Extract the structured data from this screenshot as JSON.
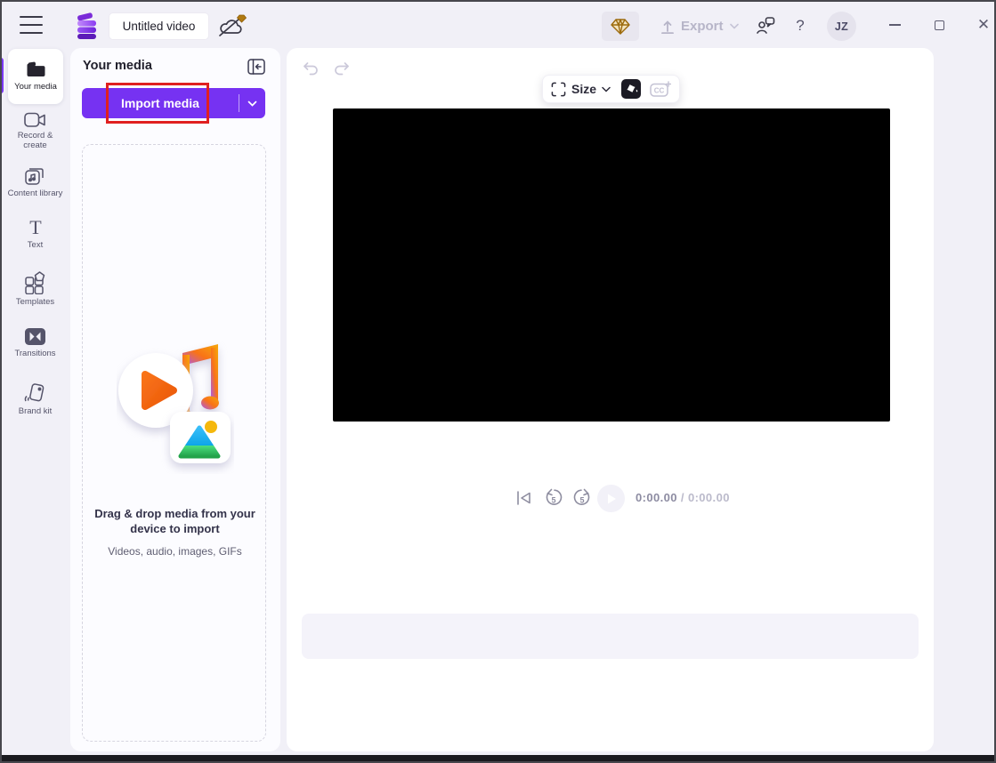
{
  "titlebar": {
    "title_value": "Untitled video",
    "export_label": "Export",
    "help_label": "?",
    "avatar_initials": "JZ",
    "close_glyph": "✕"
  },
  "sidebar": {
    "items": [
      {
        "label": "Your media"
      },
      {
        "label": "Record & create"
      },
      {
        "label": "Content library"
      },
      {
        "label": "Text"
      },
      {
        "label": "Templates"
      },
      {
        "label": "Transitions"
      },
      {
        "label": "Brand kit"
      }
    ]
  },
  "media_panel": {
    "header": "Your media",
    "import_button_label": "Import media",
    "dropzone_title": "Drag & drop media from your device to import",
    "dropzone_subtitle": "Videos, audio, images, GIFs"
  },
  "editor": {
    "size_button_label": "Size",
    "captions_label": "CC",
    "playback": {
      "elapsed": "0:00.00",
      "duration": " / 0:00.00",
      "seek_seconds": "5"
    }
  },
  "colors": {
    "accent_purple": "#7632f2",
    "highlight_red": "#e02020",
    "premium_gold": "#a8720f",
    "canvas_black": "#000000"
  }
}
